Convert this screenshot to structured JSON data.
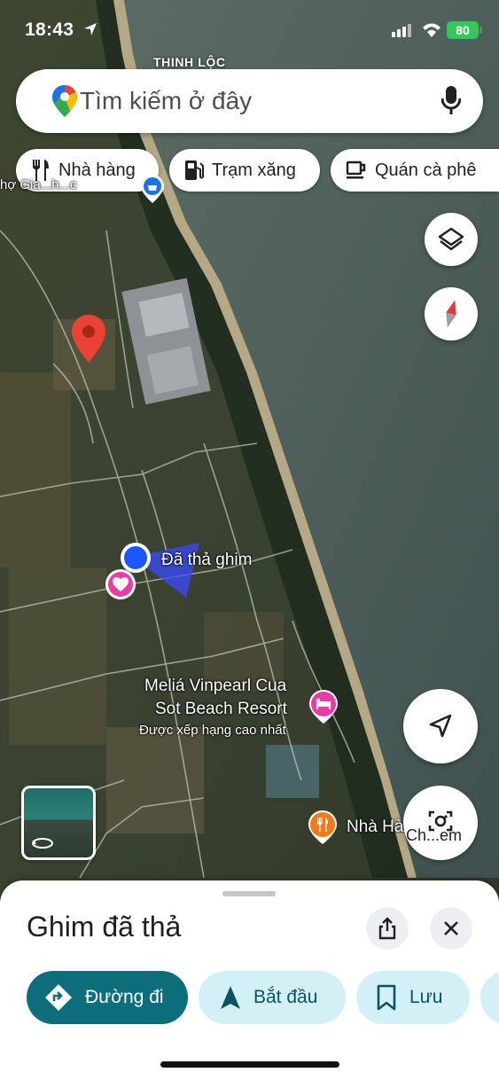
{
  "status_bar": {
    "time": "18:43",
    "battery": "80"
  },
  "search": {
    "placeholder": "Tìm kiếm ở đây"
  },
  "chips": [
    {
      "label": "Nhà hàng",
      "icon": "fork-knife-icon"
    },
    {
      "label": "Trạm xăng",
      "icon": "gas-station-icon"
    },
    {
      "label": "Quán cà phê",
      "icon": "coffee-cup-icon"
    }
  ],
  "map": {
    "area_label": "THINH LỘC",
    "market_label": "hợ Gia...h...c",
    "dropped_pin_label": "Đã thả ghim",
    "resort": {
      "name_line1": "Meliá Vinpearl Cua",
      "name_line2": "Sot Beach Resort",
      "rating_note": "Được xếp hạng cao nhất"
    },
    "restaurant_label": "Nhà Hà...h N",
    "camera_button_label": "Ch...em"
  },
  "sheet": {
    "title": "Ghim đã thả",
    "actions": [
      {
        "label": "Đường đi",
        "icon": "directions-icon"
      },
      {
        "label": "Bắt đầu",
        "icon": "navigation-arrow-icon"
      },
      {
        "label": "Lưu",
        "icon": "bookmark-icon"
      }
    ]
  },
  "colors": {
    "primary": "#0b6e7a",
    "tonal": "#d3f0f7",
    "pin_red": "#e94235",
    "user_dot": "#1a57ff",
    "hotel_pink": "#e83ea4",
    "restaurant_orange": "#f07a1a"
  }
}
